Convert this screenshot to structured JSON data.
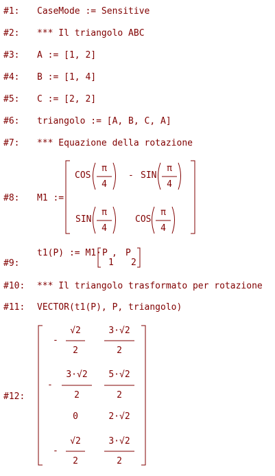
{
  "lines": [
    {
      "num": "#1:",
      "text": "CaseMode := Sensitive"
    },
    {
      "num": "#2:",
      "text": "*** Il triangolo ABC"
    },
    {
      "num": "#3:",
      "text": "A := [1, 2]"
    },
    {
      "num": "#4:",
      "text": "B := [1, 4]"
    },
    {
      "num": "#5:",
      "text": "C := [2, 2]"
    },
    {
      "num": "#6:",
      "text": "triangolo := [A, B, C, A]"
    },
    {
      "num": "#7:",
      "text": "*** Equazione della rotazione"
    }
  ],
  "line8": {
    "num": "#8:",
    "lhs": "M1 :=",
    "cos": "COS",
    "sin": "SIN",
    "minus": "-",
    "pi": "π",
    "four": "4"
  },
  "line9": {
    "num": "#9:",
    "lhs": "t1(P) := M1·",
    "p": "P",
    "comma": ",",
    "sub1": "1",
    "sub2": "2"
  },
  "lines_after": [
    {
      "num": "#10:",
      "text": "*** Il triangolo trasformato per rotazione"
    },
    {
      "num": "#11:",
      "text": "VECTOR(t1(P), P, triangolo)"
    }
  ],
  "line12": {
    "num": "#12:",
    "minus": "-",
    "sqrt2": "√2",
    "three_sqrt2": "3·√2",
    "five_sqrt2": "5·√2",
    "two_sqrt2": "2·√2",
    "zero": "0",
    "two": "2"
  }
}
